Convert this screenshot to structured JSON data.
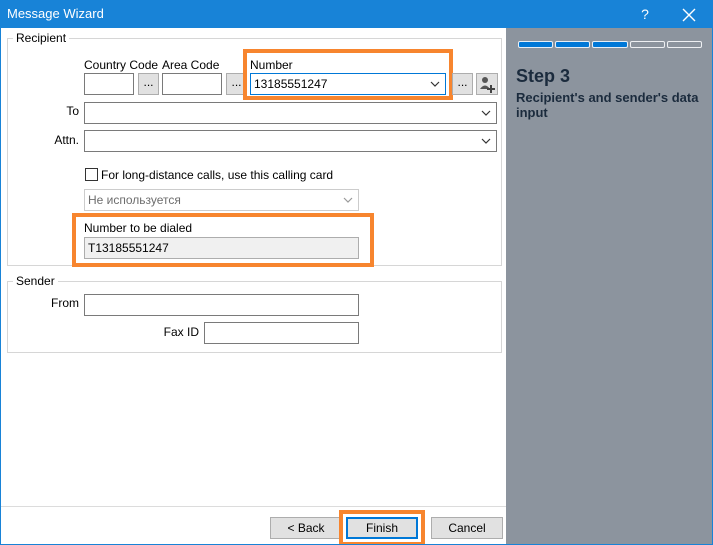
{
  "window": {
    "title": "Message Wizard",
    "help_label": "?",
    "close_label": "✕"
  },
  "recipient": {
    "legend": "Recipient",
    "country_code_label": "Country Code",
    "country_code_value": "",
    "area_code_label": "Area Code",
    "area_code_value": "",
    "number_label": "Number",
    "number_value": "13185551247",
    "browse_label": "...",
    "to_label": "To",
    "to_value": "",
    "attn_label": "Attn.",
    "attn_value": "",
    "calling_card_label": "For long-distance calls, use this calling card",
    "calling_card_checked": false,
    "calling_card_value": "Не используется",
    "dialed_label": "Number to be dialed",
    "dialed_value": "T13185551247"
  },
  "sender": {
    "legend": "Sender",
    "from_label": "From",
    "from_value": "",
    "faxid_label": "Fax ID",
    "faxid_value": ""
  },
  "buttons": {
    "back": "< Back",
    "finish": "Finish",
    "cancel": "Cancel"
  },
  "side": {
    "progress": {
      "completed_steps": 3,
      "total_steps": 5
    },
    "step_title": "Step 3",
    "step_desc": "Recipient's and sender's data input"
  },
  "colors": {
    "titlebar": "#1883d7",
    "side_panel": "#8c949e",
    "highlight": "#f7852e",
    "accent": "#0078d7"
  }
}
